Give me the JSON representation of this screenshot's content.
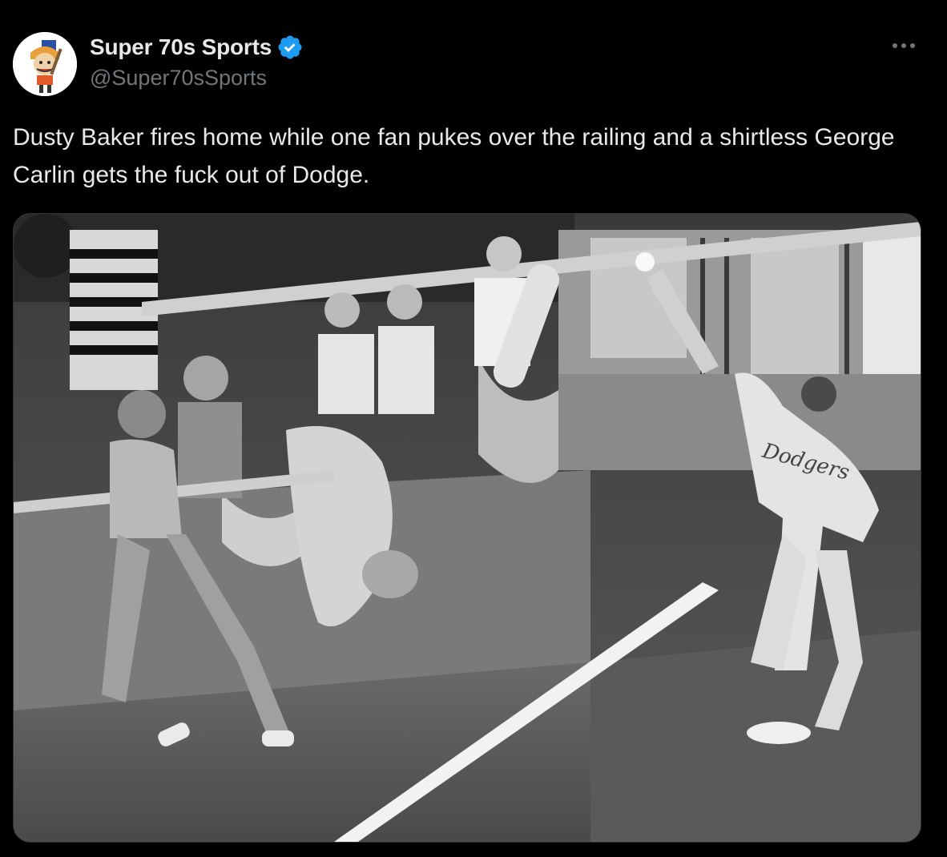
{
  "tweet": {
    "author": {
      "display_name": "Super 70s Sports",
      "handle": "@Super70sSports",
      "verified_badge_color": "#1d9bf0",
      "avatar_icon": "cartoon-mascot-avatar"
    },
    "more_icon": "ellipsis-icon",
    "text": "Dusty Baker fires home while one fan pukes over the railing and a shirtless George Carlin gets the fuck out of Dodge.",
    "media": {
      "jersey_text": "Dodgers"
    }
  },
  "colors": {
    "background": "#000000",
    "text_primary": "#e7e9ea",
    "text_secondary": "#71767b",
    "border": "#2f3336"
  }
}
